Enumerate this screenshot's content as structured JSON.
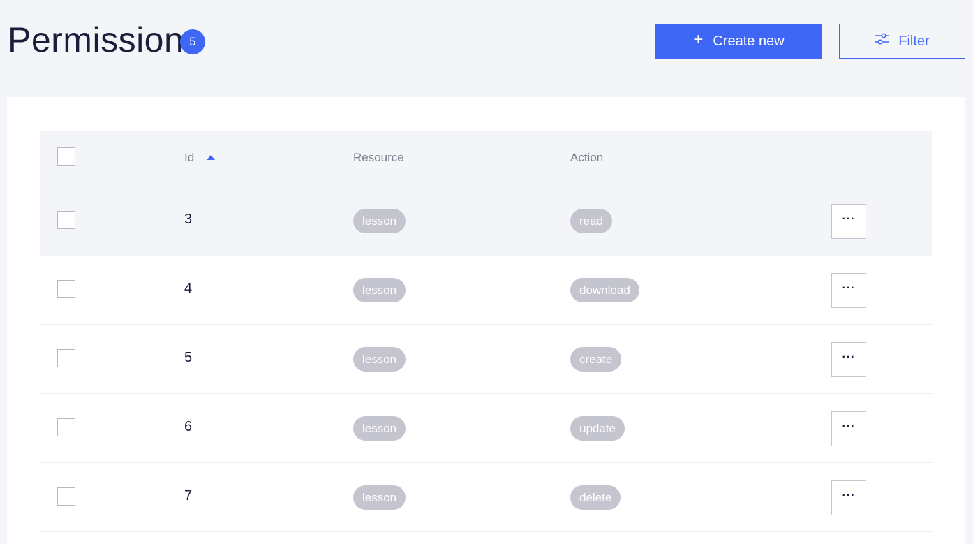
{
  "header": {
    "title": "Permission",
    "count": "5",
    "create_label": "Create new",
    "create_icon": "plus-icon",
    "filter_label": "Filter",
    "filter_icon": "sliders-icon"
  },
  "colors": {
    "accent": "#3f67f5",
    "chip": "#c4c5cf",
    "background": "#f4f5f9"
  },
  "table": {
    "columns": {
      "id": "Id",
      "resource": "Resource",
      "action": "Action"
    },
    "sort": {
      "column": "Id",
      "direction": "ascending",
      "icon": "sort-up-icon"
    },
    "more_label": "···",
    "rows": [
      {
        "id": "3",
        "resource": "lesson",
        "action": "read"
      },
      {
        "id": "4",
        "resource": "lesson",
        "action": "download"
      },
      {
        "id": "5",
        "resource": "lesson",
        "action": "create"
      },
      {
        "id": "6",
        "resource": "lesson",
        "action": "update"
      },
      {
        "id": "7",
        "resource": "lesson",
        "action": "delete"
      }
    ]
  }
}
